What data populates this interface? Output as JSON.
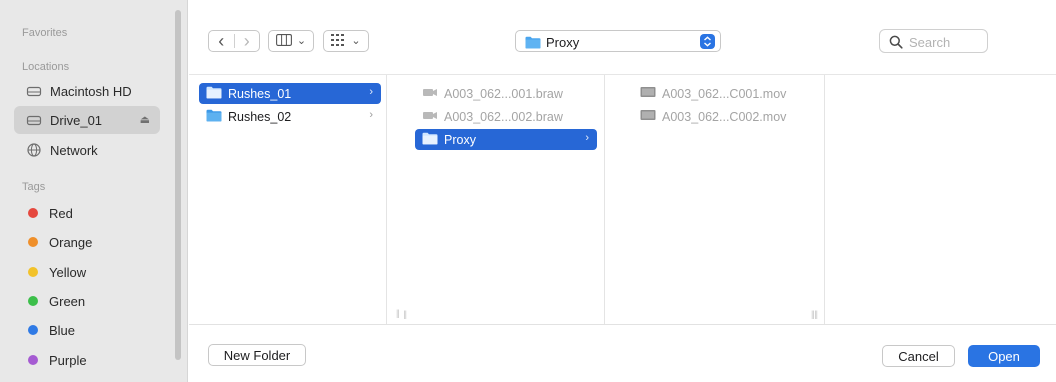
{
  "sidebar": {
    "favorites_heading": "Favorites",
    "locations_heading": "Locations",
    "locations": [
      {
        "label": "Macintosh HD",
        "icon": "internal-drive-icon"
      },
      {
        "label": "Drive_01",
        "icon": "external-drive-icon",
        "selected": true,
        "eject": "⏏"
      },
      {
        "label": "Network",
        "icon": "network-globe-icon"
      }
    ],
    "tags_heading": "Tags",
    "tags": [
      {
        "label": "Red",
        "color": "#e5483e"
      },
      {
        "label": "Orange",
        "color": "#ef8f2a"
      },
      {
        "label": "Yellow",
        "color": "#f2c22a"
      },
      {
        "label": "Green",
        "color": "#3cbf4a"
      },
      {
        "label": "Blue",
        "color": "#2f7ae5"
      },
      {
        "label": "Purple",
        "color": "#a55bd2"
      }
    ]
  },
  "toolbar": {
    "back_glyph": "‹",
    "forward_glyph": "›",
    "view_caret": "⌄",
    "group_caret": "⌄",
    "path_label": "Proxy",
    "search_placeholder": "Search"
  },
  "columns": {
    "col1": [
      {
        "label": "Rushes_01",
        "selected": true,
        "chevron": "›"
      },
      {
        "label": "Rushes_02",
        "selected": false,
        "chevron": "›"
      }
    ],
    "col2": [
      {
        "label": "A003_062...001.braw",
        "dimmed": true
      },
      {
        "label": "A003_062...002.braw",
        "dimmed": true
      },
      {
        "label": "Proxy",
        "selected": true,
        "chevron": "›"
      }
    ],
    "col3": [
      {
        "label": "A003_062...C001.mov",
        "dimmed": true
      },
      {
        "label": "A003_062...C002.mov",
        "dimmed": true
      }
    ],
    "resize_glyph": "||"
  },
  "footer": {
    "new_folder": "New Folder",
    "cancel": "Cancel",
    "open": "Open"
  },
  "colors": {
    "accent": "#2a74e3",
    "selection": "#2767d6",
    "folder": "#4aa5ee",
    "sidebar_bg": "#e8e8e8"
  }
}
